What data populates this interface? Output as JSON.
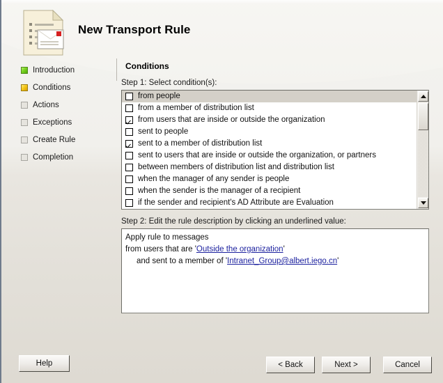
{
  "window": {
    "title": "New Transport Rule",
    "icon": "transport-rule-document-icon"
  },
  "sidebar": {
    "items": [
      {
        "label": "Introduction",
        "state": "done"
      },
      {
        "label": "Conditions",
        "state": "current"
      },
      {
        "label": "Actions",
        "state": "pending"
      },
      {
        "label": "Exceptions",
        "state": "pending"
      },
      {
        "label": "Create Rule",
        "state": "pending"
      },
      {
        "label": "Completion",
        "state": "pending"
      }
    ]
  },
  "content": {
    "section_title": "Conditions",
    "step1_label": "Step 1: Select condition(s):",
    "step2_label": "Step 2: Edit the rule description by clicking an underlined value:",
    "conditions": [
      {
        "label": "from people",
        "checked": false,
        "selected": true
      },
      {
        "label": "from a member of distribution list",
        "checked": false,
        "selected": false
      },
      {
        "label": "from users that are inside or outside the organization",
        "checked": true,
        "selected": false
      },
      {
        "label": "sent to people",
        "checked": false,
        "selected": false
      },
      {
        "label": "sent to a member of distribution list",
        "checked": true,
        "selected": false
      },
      {
        "label": "sent to users that are inside or outside the organization, or partners",
        "checked": false,
        "selected": false
      },
      {
        "label": "between members of distribution list and distribution list",
        "checked": false,
        "selected": false
      },
      {
        "label": "when the manager of any sender is people",
        "checked": false,
        "selected": false
      },
      {
        "label": "when the sender is the manager of a recipient",
        "checked": false,
        "selected": false
      },
      {
        "label": "if the sender and recipient's AD Attribute are Evaluation",
        "checked": false,
        "selected": false
      }
    ],
    "description": {
      "line1": "Apply rule to messages",
      "line2_prefix": "from users that are '",
      "line2_link": "Outside the organization",
      "line2_suffix": "'",
      "line3_prefix": "and sent to a member of '",
      "line3_link": "Intranet_Group@albert.iego.cn",
      "line3_suffix": "'"
    }
  },
  "footer": {
    "help": "Help",
    "back": "< Back",
    "next": "Next >",
    "cancel": "Cancel"
  },
  "colors": {
    "accent_done": "#79d321",
    "accent_current": "#f6c91b",
    "link": "#1a1f9e",
    "selection": "#d4d0c8",
    "dialog_background": "#e9e6e0"
  }
}
